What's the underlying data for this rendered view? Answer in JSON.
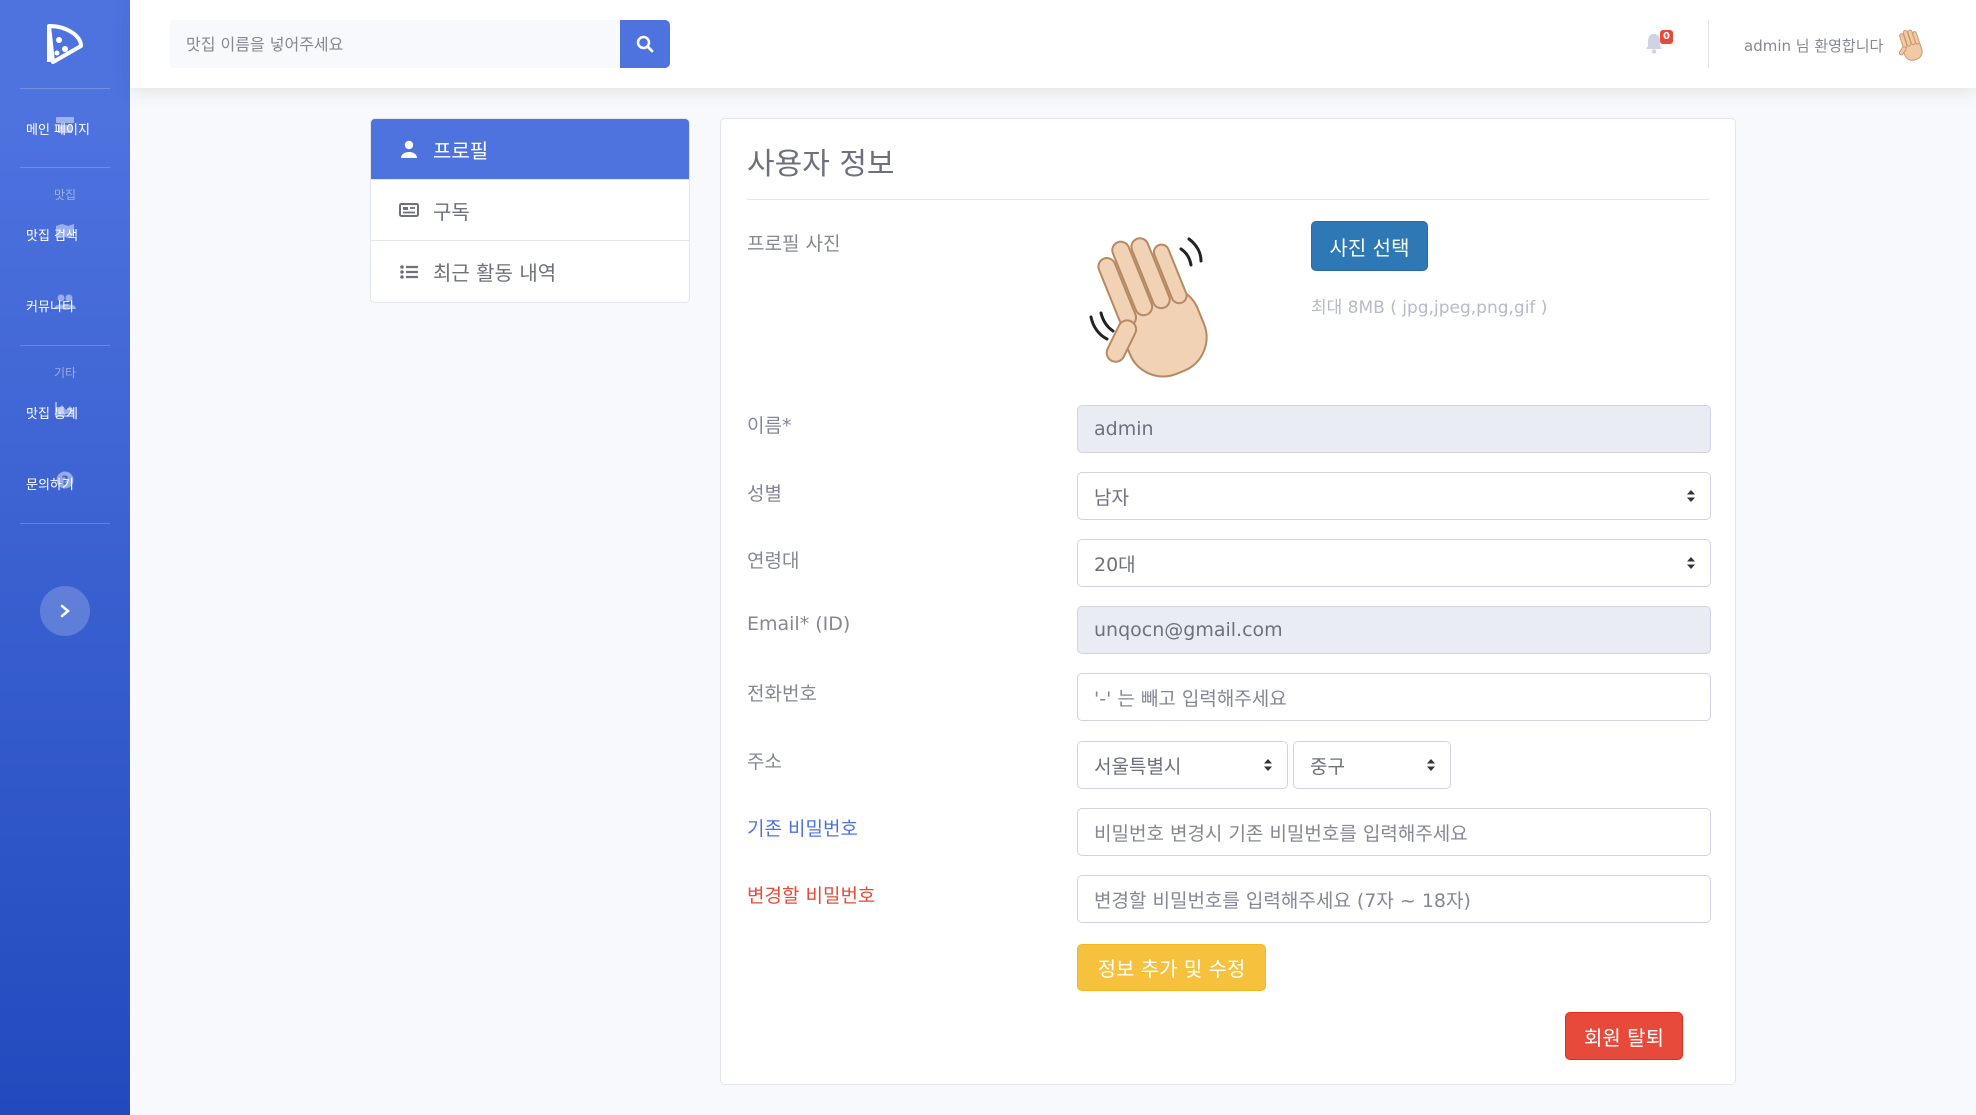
{
  "sidebar": {
    "items": [
      {
        "label": "메인 페이지",
        "icon": "store-icon"
      },
      {
        "heading": "맛집"
      },
      {
        "label": "맛집 검색",
        "icon": "map-icon"
      },
      {
        "label": "커뮤니티",
        "icon": "users-icon"
      },
      {
        "heading": "기타"
      },
      {
        "label": "맛집 통계",
        "icon": "chart-area-icon"
      },
      {
        "label": "문의하기",
        "icon": "question-circle-icon"
      }
    ],
    "toggle_icon": "chevron-right-icon"
  },
  "topbar": {
    "search_placeholder": "맛집 이름을 넣어주세요",
    "notification_count": "0",
    "greeting": "admin 님 환영합니다"
  },
  "menu": {
    "items": [
      {
        "label": "프로필",
        "icon": "user-icon",
        "active": true
      },
      {
        "label": "구독",
        "icon": "newspaper-icon"
      },
      {
        "label": "최근 활동 내역",
        "icon": "list-icon"
      }
    ]
  },
  "form": {
    "title": "사용자 정보",
    "photo_label": "프로필 사진",
    "photo_button": "사진 선택",
    "photo_hint": "최대 8MB ( jpg,jpeg,png,gif )",
    "name_label": "이름*",
    "name_value": "admin",
    "gender_label": "성별",
    "gender_value": "남자",
    "age_label": "연령대",
    "age_value": "20대",
    "email_label": "Email* (ID)",
    "email_value": "unqocn@gmail.com",
    "phone_label": "전화번호",
    "phone_placeholder": "'-' 는 빼고 입력해주세요",
    "address_label": "주소",
    "city_value": "서울특별시",
    "district_value": "중구",
    "old_pw_label": "기존 비밀번호",
    "old_pw_placeholder": "비밀번호 변경시 기존 비밀번호를 입력해주세요",
    "new_pw_label": "변경할 비밀번호",
    "new_pw_placeholder": "변경할 비밀번호를 입력해주세요 (7자 ~ 18자)",
    "submit_label": "정보 추가 및 수정",
    "withdraw_label": "회원 탈퇴"
  },
  "colors": {
    "primary": "#4e73df",
    "warning": "#f6c23e",
    "danger": "#e74a3b",
    "info_button": "#2e78b5"
  }
}
